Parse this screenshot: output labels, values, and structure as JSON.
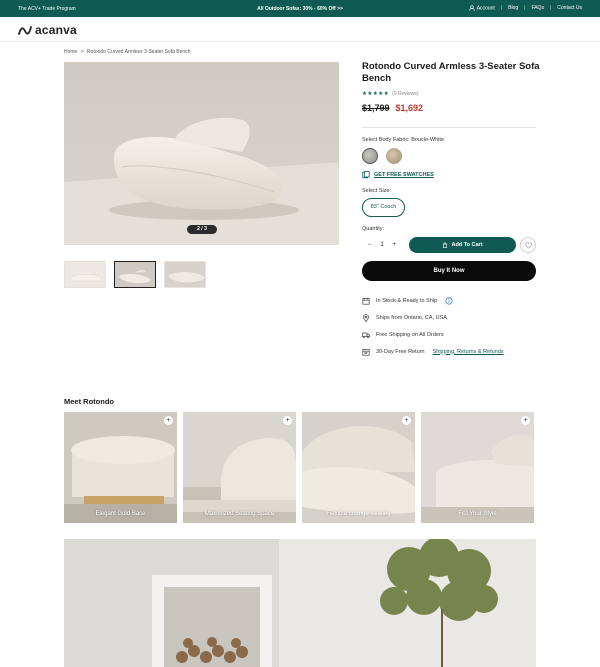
{
  "topbar": {
    "trade_program": "The ACV+ Trade Program",
    "promo": "All Outdoor Sofas: 30% - 60% Off >>",
    "account": "Account",
    "blog": "Blog",
    "faqs": "FAQs",
    "contact": "Contact Us",
    "bg_color": "#0f5b54"
  },
  "header": {
    "logo_text": "acanva"
  },
  "breadcrumb": {
    "home": "Home",
    "separator": ">",
    "current": "Rotondo Curved Armless 3-Seater Sofa Bench"
  },
  "gallery": {
    "counter": "2 / 3",
    "thumbnails": 3,
    "active_thumb": 2
  },
  "product": {
    "title": "Rotondo Curved Armless 3-Seater Sofa Bench",
    "rating": 5,
    "reviews": "(9 Reviews)",
    "price_old": "$1,799",
    "price_new": "$1,692",
    "fabric_label": "Select Body Fabric: Boucle-White",
    "free_swatches": "GET FREE SWATCHES",
    "size_label": "Select Size:",
    "size_option": "83\" Couch",
    "quantity_label": "Quantity:",
    "quantity": "1",
    "add_to_cart": "Add To Cart",
    "buy_now": "Buy It Now"
  },
  "info": {
    "stock": "In Stock & Ready to Ship",
    "ships_from": "Ships from Ontario, CA, USA",
    "free_shipping": "Free Shipping on All Orders",
    "return_prefix": "30-Day Free Return",
    "return_link": "Shipping, Returns & Refunds"
  },
  "meet": {
    "title": "Meet Rotondo",
    "features": [
      {
        "caption": "Elegant Gold Base"
      },
      {
        "caption": "Maximized Seating Space"
      },
      {
        "caption": "Flexible Lounge Seating"
      },
      {
        "caption": "Fits Your Style"
      }
    ]
  },
  "colors": {
    "accent": "#0f5b54",
    "sale": "#c0392b",
    "buy_now": "#0b0b0b"
  }
}
